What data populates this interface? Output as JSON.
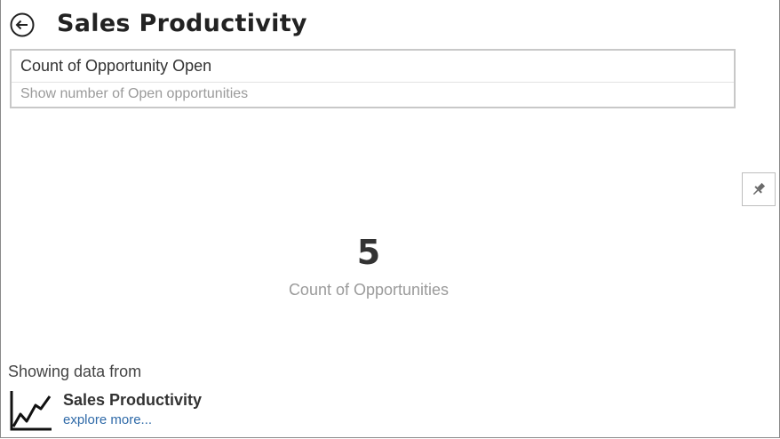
{
  "header": {
    "title": "Sales Productivity",
    "back_icon": "back-arrow-icon"
  },
  "query": {
    "value": "Count of Opportunity Open",
    "suggestion": "Show number of Open opportunities"
  },
  "pin": {
    "icon": "pin-icon"
  },
  "kpi": {
    "value": "5",
    "label": "Count of Opportunities"
  },
  "source": {
    "heading": "Showing data from",
    "name": "Sales Productivity",
    "link": "explore more...",
    "icon": "line-chart-icon"
  },
  "colors": {
    "link": "#2f6aa8",
    "muted_text": "#9b9b9b",
    "border": "#c8c8c8"
  }
}
